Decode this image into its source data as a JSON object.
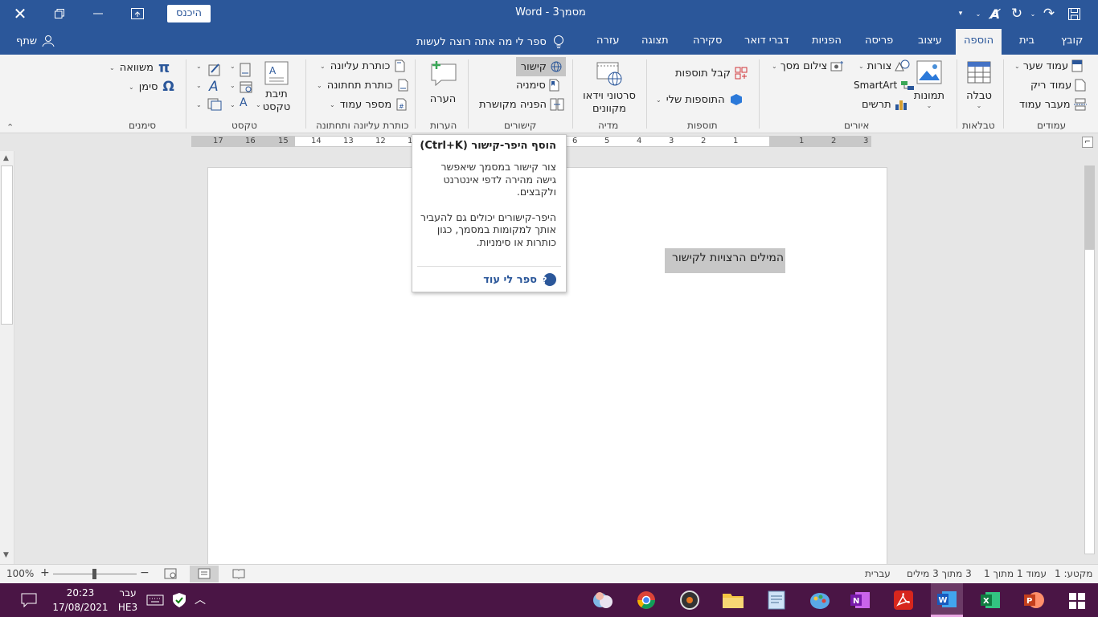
{
  "window": {
    "title": "מסמך3 - Word",
    "signin_label": "היכנס",
    "tell_me": "ספר לי מה אתה רוצה לעשות",
    "share_label": "שתף"
  },
  "tabs": [
    "קובץ",
    "בית",
    "הוספה",
    "עיצוב",
    "פריסה",
    "הפניות",
    "דברי דואר",
    "סקירה",
    "תצוגה",
    "עזרה"
  ],
  "active_tab": "הוספה",
  "ribbon": {
    "pages": {
      "label": "עמודים",
      "cover": "עמוד שער",
      "blank": "עמוד ריק",
      "break": "מעבר עמוד"
    },
    "tables": {
      "label": "טבלאות",
      "table": "טבלה"
    },
    "illustrations": {
      "label": "איורים",
      "pictures": "תמונות",
      "shapes": "צורות",
      "smartart": "SmartArt",
      "chart": "תרשים",
      "screenshot": "צילום מסך"
    },
    "addins": {
      "label": "תוספות",
      "get": "קבל תוספות",
      "my": "התוספות שלי"
    },
    "media": {
      "label": "מדיה",
      "online_video_1": "סרטוני וידאו",
      "online_video_2": "מקוונים"
    },
    "links": {
      "label": "קישורים",
      "link": "קישור",
      "bookmark": "סימניה",
      "crossref": "הפניה מקושרת"
    },
    "comments": {
      "label": "הערות",
      "comment": "הערה"
    },
    "header_footer": {
      "label": "כותרת עליונה ותחתונה",
      "header": "כותרת עליונה",
      "footer": "כותרת תחתונה",
      "page_number": "מספר עמוד"
    },
    "text": {
      "label": "טקסט",
      "textbox_1": "תיבת",
      "textbox_2": "טקסט"
    },
    "symbols": {
      "label": "סימנים",
      "equation": "משוואה",
      "symbol": "סימן"
    }
  },
  "tooltip": {
    "title": "הוסף היפר-קישור (Ctrl+K)",
    "body1": "צור קישור במסמך שיאפשר גישה מהירה לדפי אינטרנט ולקבצים.",
    "body2": "היפר-קישורים יכולים גם להעביר אותך למקומות במסמך, כגון כותרות או סימניות.",
    "more": "ספר לי עוד"
  },
  "document": {
    "selected_text": "המילים הרצויות לקישור"
  },
  "ruler": {
    "numbers_left": [
      "17",
      "16",
      "15",
      "14",
      "13",
      "12",
      "1"
    ],
    "numbers_right": [
      "6",
      "5",
      "4",
      "3",
      "2",
      "1",
      "1",
      "2",
      "3"
    ]
  },
  "status": {
    "section": "מקטע: 1",
    "page": "עמוד 1 מתוך 1",
    "words": "3 מתוך 3 מילים",
    "language": "עברית",
    "zoom": "100%",
    "zoom_minus": "−",
    "zoom_plus": "+"
  },
  "taskbar": {
    "time": "20:23",
    "date": "17/08/2021",
    "lang1": "עבר",
    "lang2": "HE3"
  },
  "colors": {
    "word_blue": "#2b579a",
    "taskbar": "#4a1545",
    "selection": "#c7c7c7"
  }
}
